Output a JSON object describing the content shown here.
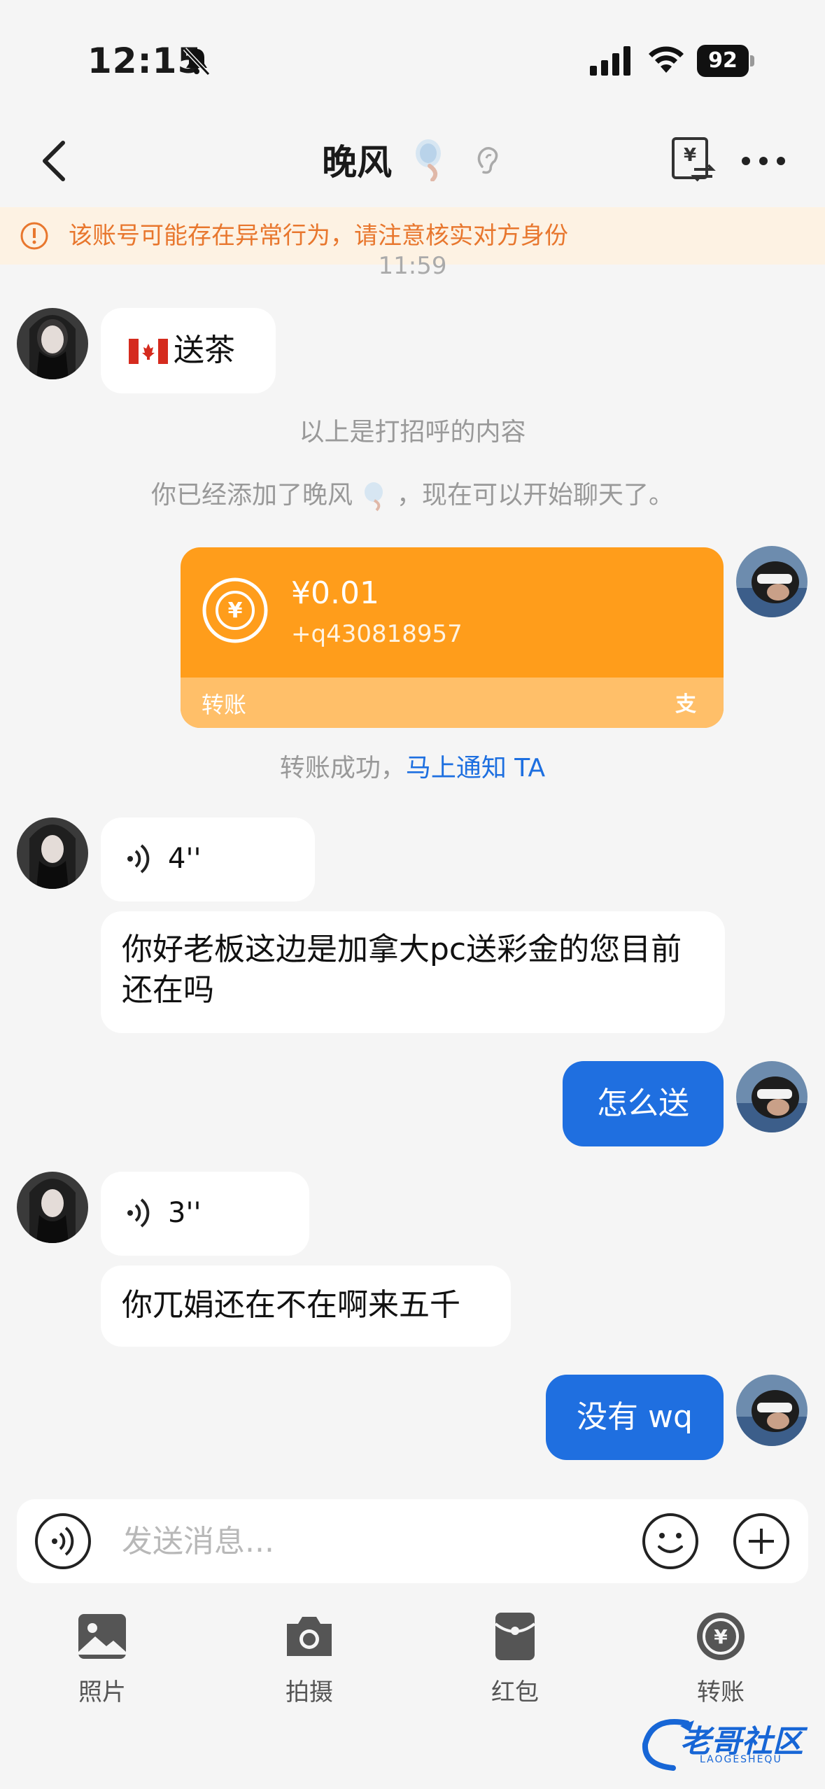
{
  "status_bar": {
    "time": "12:15",
    "battery": "92"
  },
  "nav": {
    "title": "晚风"
  },
  "warning": {
    "text": "该账号可能存在异常行为，请注意核实对方身份"
  },
  "chat": {
    "time_label": "11:59",
    "greeting_message": "送茶",
    "system_greeting": "以上是打招呼的内容",
    "system_added_prefix": "你已经添加了晚风",
    "system_added_suffix": "，现在可以开始聊天了。",
    "transfer": {
      "amount": "¥0.01",
      "note": "+q430818957",
      "label": "转账"
    },
    "transfer_status": "转账成功，",
    "transfer_notify_link": "马上通知 TA",
    "voice_1_duration": "4''",
    "message_1": "你好老板这边是加拿大pc送彩金的您目前还在吗",
    "reply_1": "怎么送",
    "voice_2_duration": "3''",
    "message_2": "你兀娟还在不在啊来五千",
    "reply_2": "没有 wq"
  },
  "input": {
    "placeholder": "发送消息..."
  },
  "toolbar": {
    "photo": "照片",
    "camera": "拍摄",
    "red_packet": "红包",
    "transfer": "转账"
  },
  "watermark": {
    "text": "老哥社区",
    "sub": "LAOGESHEQU"
  },
  "colors": {
    "accent_blue": "#1f6fe0",
    "transfer_orange": "#ff9d1b",
    "warning_orange": "#e8772e"
  }
}
